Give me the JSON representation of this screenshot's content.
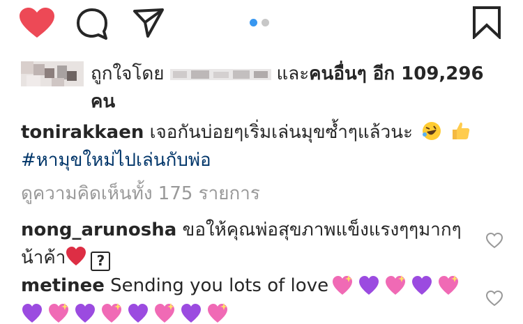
{
  "action_bar": {
    "icons": [
      "heart-filled-icon",
      "comment-icon",
      "share-icon",
      "bookmark-icon"
    ],
    "like_color": "#ed4956",
    "carousel_dots": 2,
    "active_dot": 0,
    "active_dot_color": "#3897f0"
  },
  "likes": {
    "prefix": "ถูกใจโดย",
    "connector": "และ",
    "others_label": "คนอื่นๆ อีก 109,296 คน"
  },
  "caption": {
    "username": "tonirakkaen",
    "text": "เจอกันบ่อยๆเริ่มเล่นมุขซ้ำๆแล้วนะ",
    "hashtag": "#หามุขใหม่ไปเล่นกับพ่อ"
  },
  "view_all_comments": "ดูความคิดเห็นทั้ง 175 รายการ",
  "comments": [
    {
      "username": "nong_arunosha",
      "text": "ขอให้คุณพ่อสุขภาพแข็งแรงๆๆมากๆ",
      "text_line2": "น้าค้า",
      "unknown_glyph": "?"
    },
    {
      "username": "metinee",
      "text": "Sending you lots of love"
    }
  ],
  "colors": {
    "text": "#262626",
    "muted": "#999999",
    "hashtag": "#003569",
    "purple_heart": "#9b4be0",
    "sparkle_heart": "#f06ab5"
  }
}
